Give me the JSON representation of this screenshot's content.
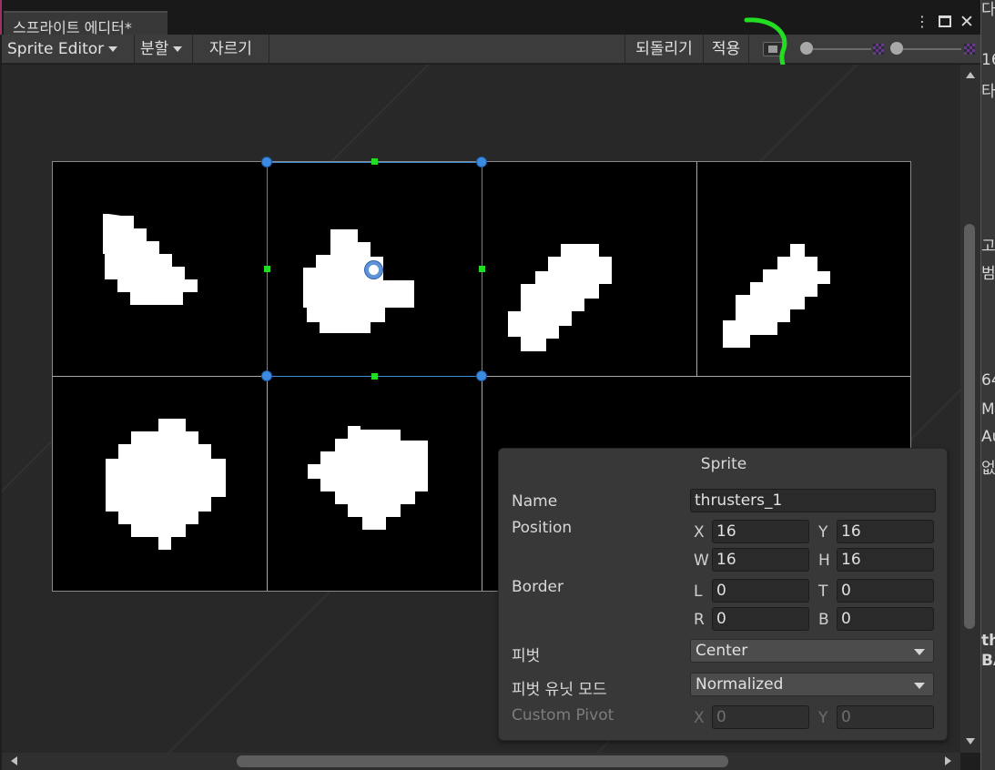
{
  "window": {
    "tab_title": "스프라이트 에디터*",
    "menu_icon": "kebab-menu-icon",
    "maximize_icon": "maximize-icon",
    "close_icon": "close-icon"
  },
  "toolbar": {
    "mode_label": "Sprite Editor",
    "slice_label": "분할",
    "trim_label": "자르기",
    "revert_label": "되돌리기",
    "apply_label": "적용"
  },
  "sprite_panel": {
    "title": "Sprite",
    "name_label": "Name",
    "name_value": "thrusters_1",
    "position_label": "Position",
    "x_label": "X",
    "x_value": "16",
    "y_label": "Y",
    "y_value": "16",
    "w_label": "W",
    "w_value": "16",
    "h_label": "H",
    "h_value": "16",
    "border_label": "Border",
    "l_label": "L",
    "l_value": "0",
    "t_label": "T",
    "t_value": "0",
    "r_label": "R",
    "r_value": "0",
    "b_label": "B",
    "b_value": "0",
    "pivot_label": "피벗",
    "pivot_value": "Center",
    "pivot_unit_label": "피벗 유닛 모드",
    "pivot_unit_value": "Normalized",
    "custom_pivot_label": "Custom Pivot",
    "cx_label": "X",
    "cx_value": "0",
    "cy_label": "Y",
    "cy_value": "0"
  },
  "inspector_strip": {
    "top_text": "다",
    "items": [
      "16",
      "타",
      "고",
      "범",
      "64",
      "Mi",
      "Au",
      "없",
      "th",
      "BA"
    ]
  }
}
